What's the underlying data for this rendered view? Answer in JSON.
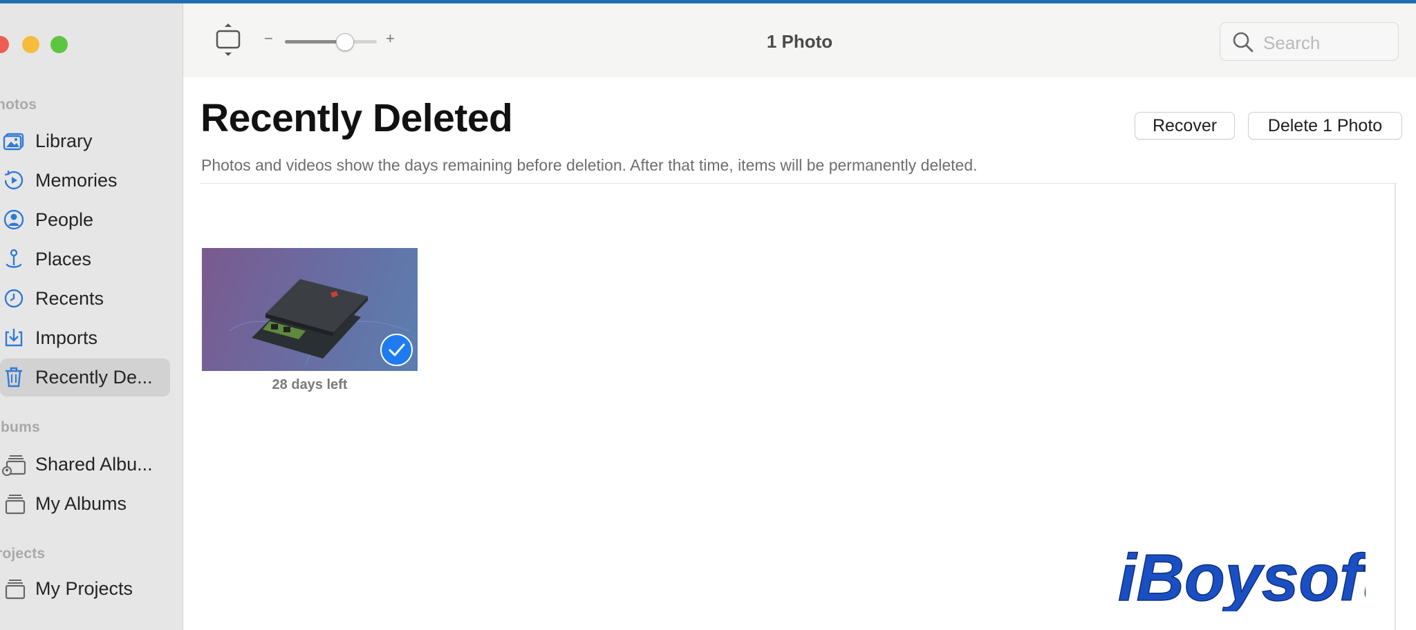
{
  "window": {
    "traffic_lights": [
      "close",
      "minimize",
      "zoom"
    ],
    "colors": {
      "close": "#ee5e55",
      "minimize": "#f4bd3c",
      "zoom": "#5ec541",
      "accent": "#1f7cf0"
    }
  },
  "sidebar": {
    "sections": [
      {
        "heading": "hotos",
        "items": [
          {
            "label": "Library",
            "icon": "library-icon"
          },
          {
            "label": "Memories",
            "icon": "memories-icon"
          },
          {
            "label": "People",
            "icon": "people-icon"
          },
          {
            "label": "Places",
            "icon": "places-icon"
          },
          {
            "label": "Recents",
            "icon": "recents-icon"
          },
          {
            "label": "Imports",
            "icon": "imports-icon"
          },
          {
            "label": "Recently De...",
            "icon": "trash-icon",
            "selected": true
          }
        ]
      },
      {
        "heading": "lbums",
        "items": [
          {
            "label": "Shared Albu...",
            "icon": "shared-albums-icon"
          },
          {
            "label": "My Albums",
            "icon": "albums-stack-icon"
          }
        ]
      },
      {
        "heading": "rojects",
        "items": [
          {
            "label": "My Projects",
            "icon": "projects-stack-icon"
          }
        ]
      }
    ]
  },
  "toolbar": {
    "zoom_minus": "−",
    "zoom_plus": "+",
    "zoom_level": 0.65,
    "count_title": "1 Photo",
    "search_placeholder": "Search"
  },
  "main": {
    "title": "Recently Deleted",
    "description": "Photos and videos show the days remaining before deletion. After that time, items will be permanently deleted.",
    "buttons": {
      "recover": "Recover",
      "delete": "Delete 1 Photo"
    },
    "photos": [
      {
        "caption": "28 days left",
        "selected": true,
        "subject": "ssd-drive-image"
      }
    ]
  },
  "watermark": {
    "text": "iBoysoft"
  }
}
